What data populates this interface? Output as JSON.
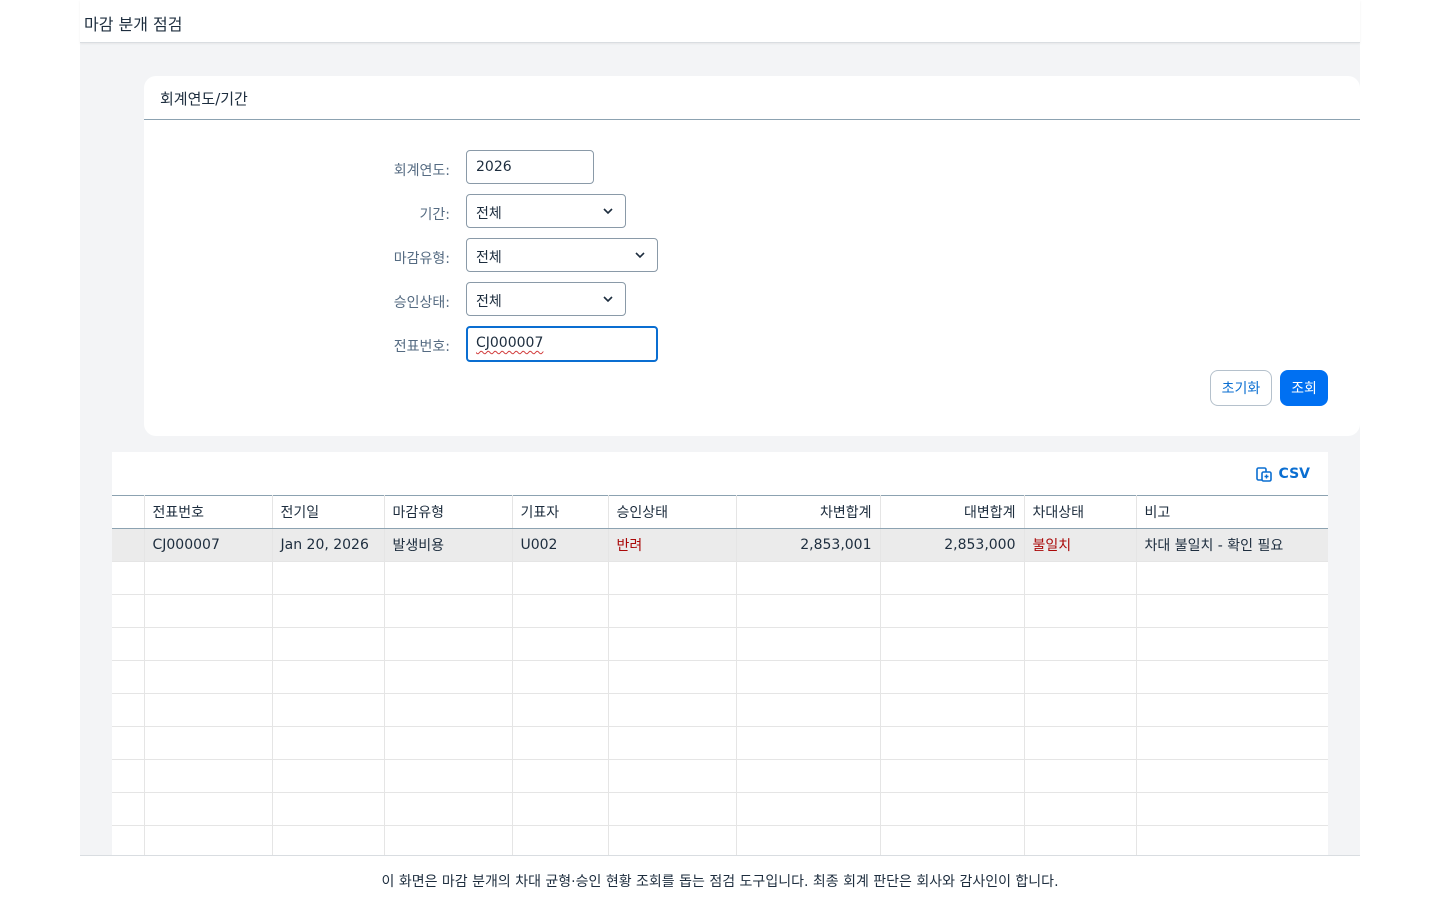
{
  "header": {
    "title": "마감 분개 점검"
  },
  "filter": {
    "section_title": "회계연도/기간",
    "fiscal_year_label": "회계연도:",
    "fiscal_year_value": "2026",
    "period_label": "기간:",
    "period_value": "전체",
    "closing_type_label": "마감유형:",
    "closing_type_value": "전체",
    "approval_status_label": "승인상태:",
    "approval_status_value": "전체",
    "journal_no_label": "전표번호:",
    "journal_no_value": "CJ000007",
    "reset_label": "초기화",
    "search_label": "조회"
  },
  "table": {
    "csv_label": "CSV",
    "columns": [
      "전표번호",
      "전기일",
      "마감유형",
      "기표자",
      "승인상태",
      "차변합계",
      "대변합계",
      "차대상태",
      "비고"
    ],
    "rows": [
      {
        "journal_no": "CJ000007",
        "posting_date": "Jan 20, 2026",
        "closing_type": "발생비용",
        "creator": "U002",
        "approval_status": "반려",
        "debit_total": "2,853,001",
        "credit_total": "2,853,000",
        "balance_status": "불일치",
        "remark": "차대 불일치 - 확인 필요"
      }
    ]
  },
  "footer": {
    "notice": "이 화면은 마감 분개의 차대 균형·승인 현황 조회를 돕는 점검 도구입니다. 최종 회계 판단은 회사와 감사인이 합니다."
  },
  "colors": {
    "accent": "#0070f2",
    "error_text": "#aa0808",
    "selected_row": "#ebebeb"
  },
  "icons": {
    "dropdown": "chevron-down-icon",
    "csv": "export-icon"
  }
}
